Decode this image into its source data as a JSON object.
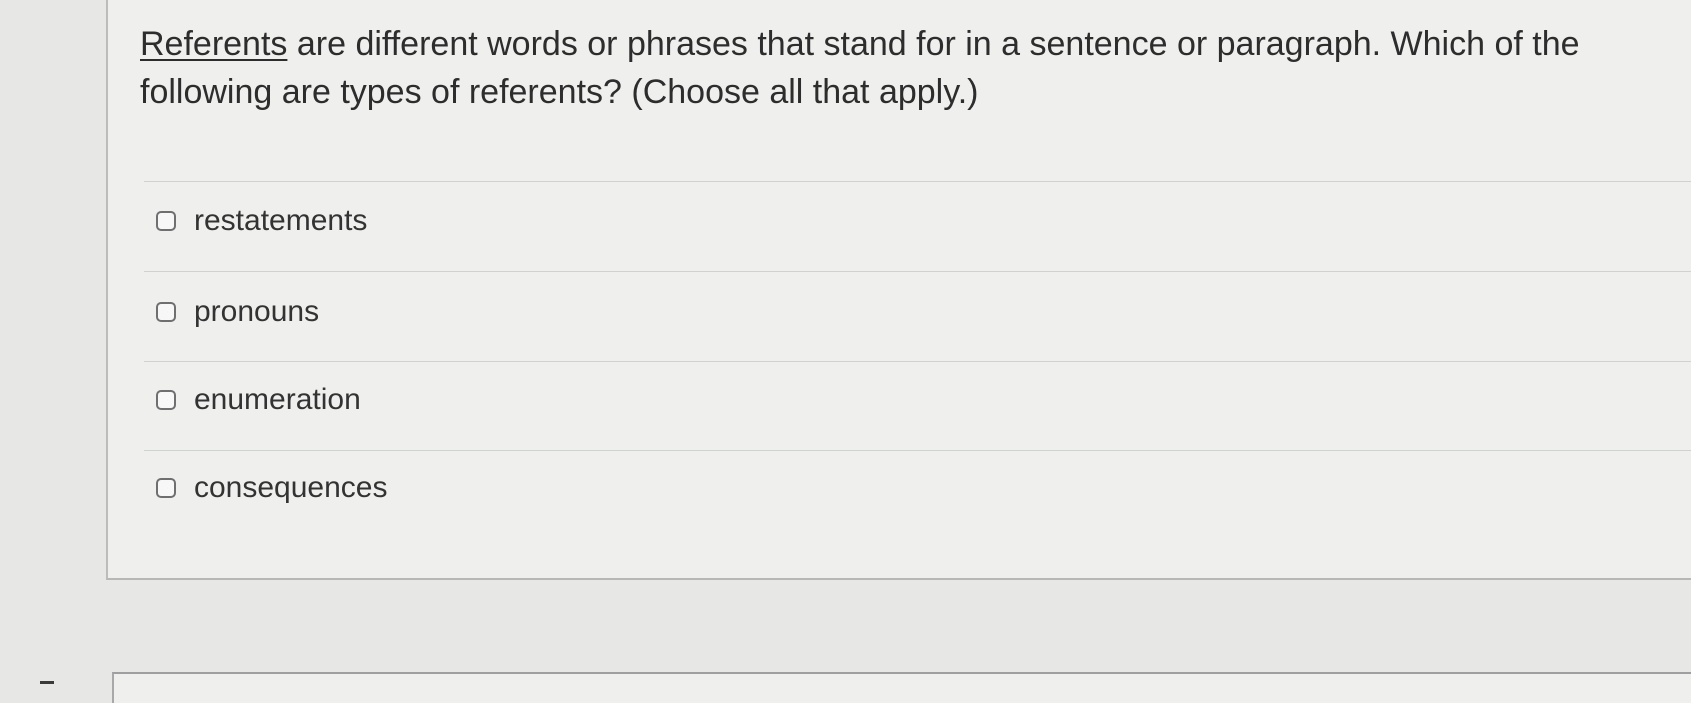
{
  "question": {
    "term": "Referents",
    "text": " are different words or phrases that stand for in a sentence or paragraph. Which of the following are types of referents? (Choose all that apply.)"
  },
  "options": [
    {
      "label": "restatements",
      "checked": false
    },
    {
      "label": "pronouns",
      "checked": false
    },
    {
      "label": "enumeration",
      "checked": false
    },
    {
      "label": "consequences",
      "checked": false
    }
  ]
}
